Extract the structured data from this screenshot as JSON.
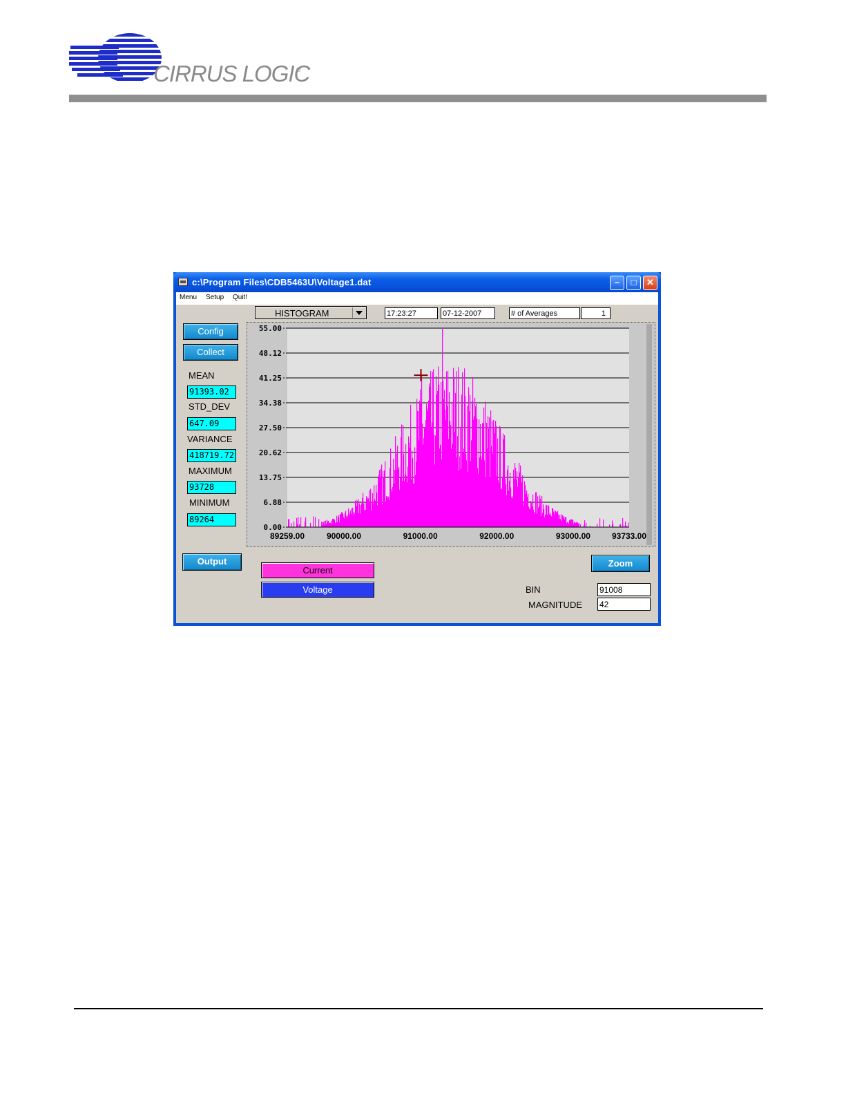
{
  "document": {
    "brand": "CIRRUS LOGIC",
    "registered_mark": "®"
  },
  "window": {
    "title": "c:\\Program Files\\CDB5463U\\Voltage1.dat",
    "menu": [
      "Menu",
      "Setup",
      "Quit!"
    ]
  },
  "toolbar": {
    "mode": "HISTOGRAM",
    "time": "17:23:27",
    "date": "07-12-2007",
    "averages_label": "# of Averages",
    "averages_value": "1"
  },
  "buttons": {
    "config": "Config",
    "collect": "Collect",
    "output": "Output",
    "zoom": "Zoom",
    "current": "Current",
    "voltage": "Voltage"
  },
  "stats": [
    {
      "label": "MEAN",
      "value": "91393.02"
    },
    {
      "label": "STD_DEV",
      "value": "647.09"
    },
    {
      "label": "VARIANCE",
      "value": "418719.72"
    },
    {
      "label": "MAXIMUM",
      "value": "93728"
    },
    {
      "label": "MINIMUM",
      "value": "89264"
    }
  ],
  "readout": {
    "bin_label": "BIN",
    "bin_value": "91008",
    "magnitude_label": "MAGNITUDE",
    "magnitude_value": "42"
  },
  "colors": {
    "histogram": "#ff00ff",
    "plot_bg": "#e1e1e1",
    "stat_field": "#00ffff",
    "cursor": "#8b0000"
  },
  "chart_data": {
    "type": "bar",
    "x_range": [
      89259.0,
      93733.0
    ],
    "y_range": [
      0,
      55
    ],
    "x_ticks": [
      "89259.00",
      "90000.00",
      "91000.00",
      "92000.00",
      "93000.00",
      "93733.00"
    ],
    "x_tick_values": [
      89259.0,
      90000.0,
      91000.0,
      92000.0,
      93000.0,
      93733.0
    ],
    "y_ticks": [
      "55.00",
      "48.12",
      "41.25",
      "34.38",
      "27.50",
      "20.62",
      "13.75",
      "6.88",
      "0.00"
    ],
    "y_tick_values": [
      55.0,
      48.12,
      41.25,
      34.38,
      27.5,
      20.62,
      13.75,
      6.88,
      0.0
    ],
    "grid": "horizontal",
    "distribution": {
      "mean": 91393.02,
      "std_dev": 647.09,
      "peak": 55,
      "peak_bin": 91280
    },
    "cursor": {
      "bin": 91008,
      "magnitude": 42
    }
  }
}
